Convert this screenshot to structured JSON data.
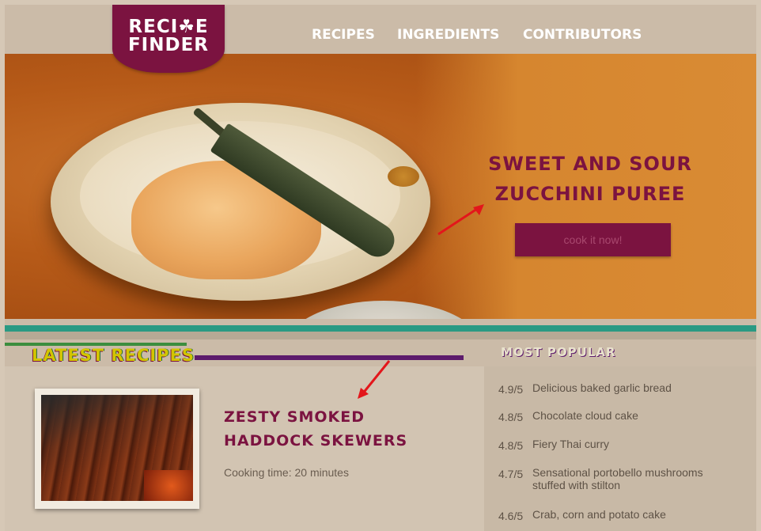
{
  "logo": {
    "line1": "RECI☘E",
    "line2": "FINDER"
  },
  "nav": {
    "items": [
      {
        "label": "RECIPES"
      },
      {
        "label": "INGREDIENTS"
      },
      {
        "label": "CONTRIBUTORS"
      }
    ]
  },
  "hero": {
    "title_line1": "SWEET AND SOUR",
    "title_line2": "ZUCCHINI PUREE",
    "cta_label": "cook it now!"
  },
  "latest": {
    "heading": "LATEST RECIPES",
    "recipe_title_line1": "ZESTY SMOKED",
    "recipe_title_line2": "HADDOCK SKEWERS",
    "cooking_time": "Cooking time: 20 minutes"
  },
  "popular": {
    "heading": "MOST POPULAR",
    "items": [
      {
        "score": "4.9/5",
        "name": "Delicious baked garlic bread"
      },
      {
        "score": "4.8/5",
        "name": "Chocolate cloud cake"
      },
      {
        "score": "4.8/5",
        "name": "Fiery Thai curry"
      },
      {
        "score": "4.7/5",
        "name": "Sensational portobello mushrooms stuffed with stilton"
      },
      {
        "score": "4.6/5",
        "name": "Crab, corn and potato cake"
      }
    ]
  },
  "colors": {
    "brand": "#7b1340",
    "annotation_arrow": "#e3161b"
  }
}
